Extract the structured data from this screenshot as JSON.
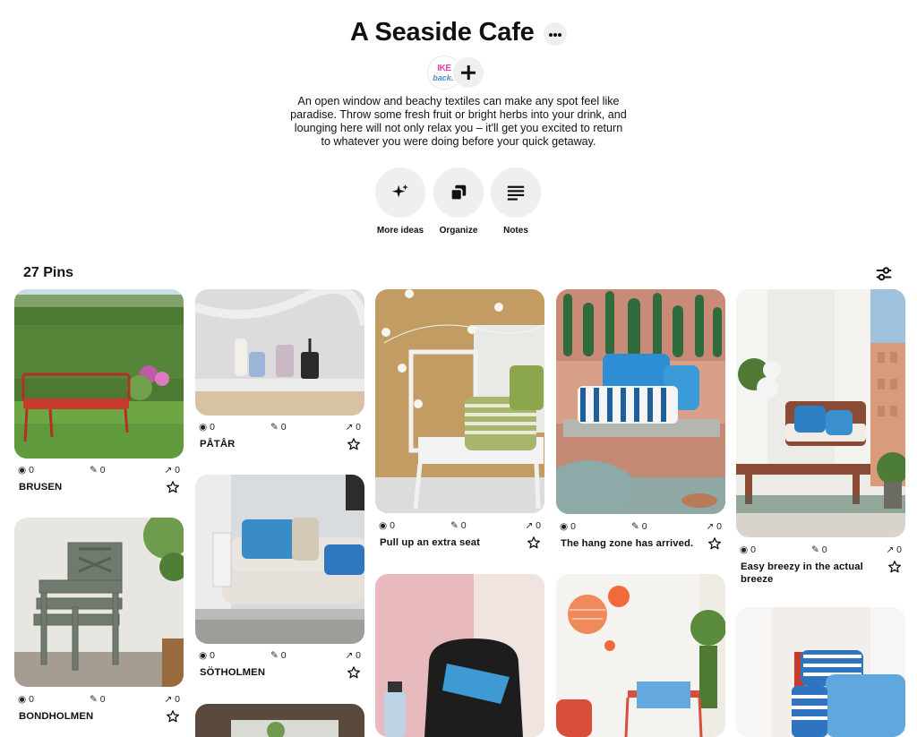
{
  "board": {
    "title": "A Seaside Cafe",
    "more_icon": "ellipsis-icon",
    "collaborator_avatar": {
      "line1": "IKE",
      "line2": "backs"
    },
    "add_collaborator_icon": "plus-icon",
    "description": "An open window and beachy textiles can make any spot feel like paradise. Throw some fresh fruit or bright herbs into your drink, and lounging here will not only relax you – it'll get you excited to return to whatever you were doing before your quick getaway."
  },
  "actions": [
    {
      "label": "More ideas",
      "icon": "sparkle-icon"
    },
    {
      "label": "Organize",
      "icon": "organize-icon"
    },
    {
      "label": "Notes",
      "icon": "notes-icon"
    }
  ],
  "pins_header": {
    "count_label": "27 Pins",
    "filter_icon": "filter-sliders-icon"
  },
  "pins": [
    {
      "title": "BRUSEN",
      "views": "0",
      "saves": "0",
      "shares": "0"
    },
    {
      "title": "BONDHOLMEN",
      "views": "0",
      "saves": "0",
      "shares": "0"
    },
    {
      "title": "PÅTÅR",
      "views": "0",
      "saves": "0",
      "shares": "0"
    },
    {
      "title": "SÖTHOLMEN",
      "views": "0",
      "saves": "0",
      "shares": "0"
    },
    {
      "title": "Pull up an extra seat",
      "views": "0",
      "saves": "0",
      "shares": "0"
    },
    {
      "title": "The hang zone has arrived.",
      "views": "0",
      "saves": "0",
      "shares": "0"
    },
    {
      "title": "Easy breezy in the actual breeze",
      "views": "0",
      "saves": "0",
      "shares": "0"
    }
  ],
  "colors": {
    "text": "#111111",
    "button_bg": "#efefef",
    "background": "#ffffff"
  }
}
